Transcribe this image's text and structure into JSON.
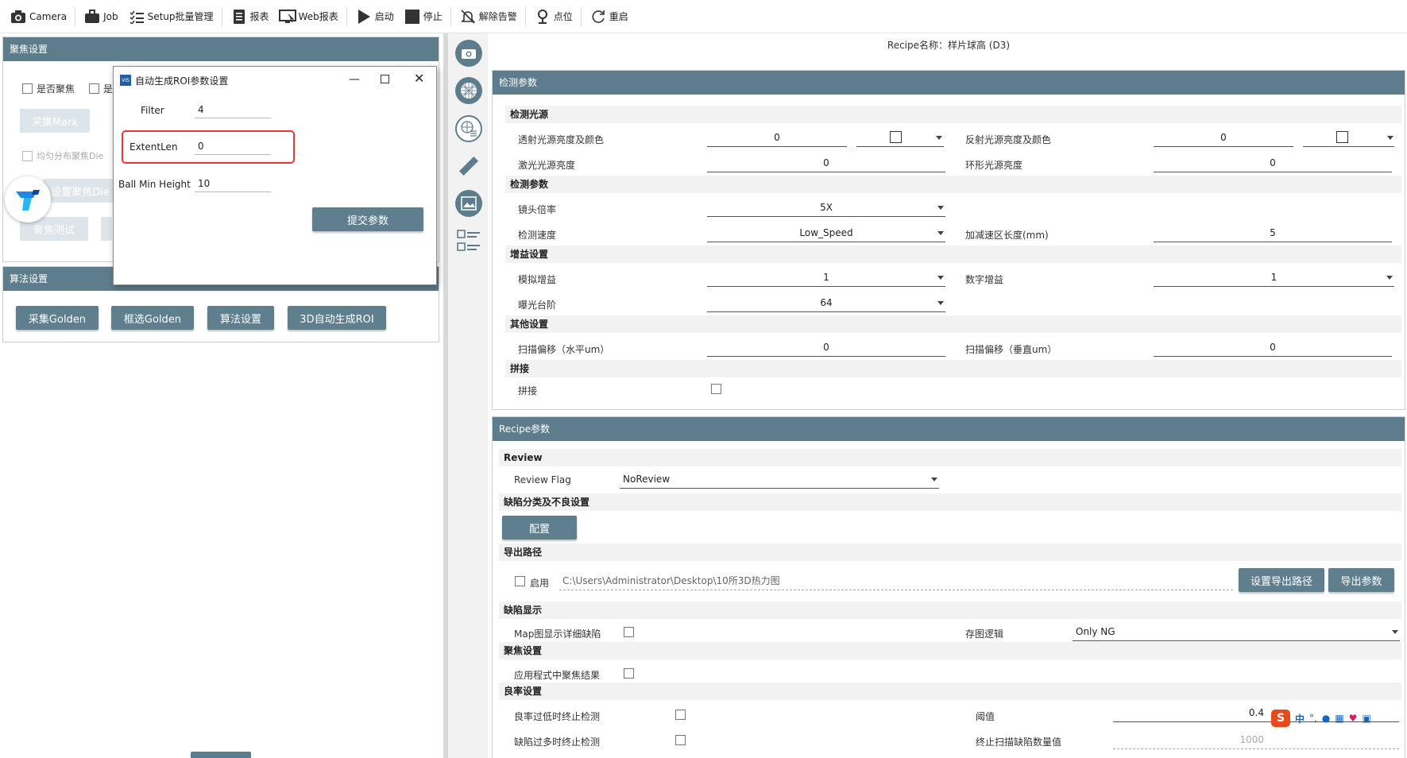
{
  "toolbar": {
    "items": [
      {
        "label": "Camera",
        "icon": "camera-icon"
      },
      {
        "label": "Job",
        "icon": "briefcase-icon"
      },
      {
        "label": "Setup批量管理",
        "icon": "list-icon"
      },
      {
        "label": "报表",
        "icon": "report-icon"
      },
      {
        "label": "Web报表",
        "icon": "monitor-icon"
      },
      {
        "label": "启动",
        "icon": "play-icon"
      },
      {
        "label": "停止",
        "icon": "stop-icon"
      },
      {
        "label": "解除告警",
        "icon": "bell-off-icon"
      },
      {
        "label": "点位",
        "icon": "location-icon"
      },
      {
        "label": "重启",
        "icon": "restart-icon"
      }
    ]
  },
  "focus_panel": {
    "title": "聚焦设置",
    "checkbox_focus": "是否聚焦",
    "checkbox_other": "是",
    "btn_capture_mark": "采集Mark",
    "checkbox_uniform": "均匀分布聚焦Die",
    "btn_set_focus_die": "设置聚焦Die",
    "btn_focus_test": "聚焦测试"
  },
  "algo_panel": {
    "title": "算法设置",
    "buttons": [
      "采集Golden",
      "框选Golden",
      "算法设置",
      "3D自动生成ROI"
    ]
  },
  "dialog": {
    "title": "自动生成ROI参数设置",
    "app_icon": "VIS",
    "filter_label": "Filter",
    "filter_value": "4",
    "extent_label": "ExtentLen",
    "extent_value": "0",
    "ball_label": "Ball Min Height",
    "ball_value": "10",
    "submit": "提交参数",
    "highlight_color": "#e53935"
  },
  "recipe_title": "Recipe名称：样片球高 (D3)",
  "detect": {
    "title": "检测参数",
    "g_light": "检测光源",
    "transmit_label": "透射光源亮度及颜色",
    "transmit_value": "0",
    "reflect_label": "反射光源亮度及颜色",
    "reflect_value": "0",
    "laser_label": "激光光源亮度",
    "laser_value": "0",
    "ring_label": "环形光源亮度",
    "ring_value": "0",
    "g_param": "检测参数",
    "lens_label": "镜头倍率",
    "lens_value": "5X",
    "speed_label": "检测速度",
    "speed_value": "Low_Speed",
    "accel_label": "加减速区长度(mm)",
    "accel_value": "5",
    "g_gain": "增益设置",
    "analog_label": "模拟增益",
    "analog_value": "1",
    "digital_label": "数字增益",
    "digital_value": "1",
    "exposure_label": "曝光台阶",
    "exposure_value": "64",
    "g_other": "其他设置",
    "scanx_label": "扫描偏移（水平um）",
    "scanx_value": "0",
    "scany_label": "扫描偏移（垂直um）",
    "scany_value": "0",
    "g_stitch": "拼接",
    "stitch_label": "拼接"
  },
  "recipe": {
    "title": "Recipe参数",
    "g_review": "Review",
    "flag_label": "Review Flag",
    "flag_value": "NoReview",
    "g_defect": "缺陷分类及不良设置",
    "config_btn": "配置",
    "g_export": "导出路径",
    "enable_label": "启用",
    "path_value": "C:\\Users\\Administrator\\Desktop\\10所3D热力图",
    "set_path_btn": "设置导出路径",
    "export_btn": "导出参数",
    "g_display": "缺陷显示",
    "map_label": "Map图显示详细缺陷",
    "save_label": "存图逻辑",
    "save_value": "Only NG",
    "g_focus": "聚焦设置",
    "apply_label": "应用程式中聚焦结果",
    "g_yield": "良率设置",
    "low_yield_label": "良率过低时终止检测",
    "threshold_label": "阈值",
    "threshold_value": "0.4",
    "many_defect_label": "缺陷过多时终止检测",
    "stop_count_label": "终止扫描缺陷数量值",
    "stop_count_value": "1000"
  },
  "ime": {
    "lang": "中"
  }
}
